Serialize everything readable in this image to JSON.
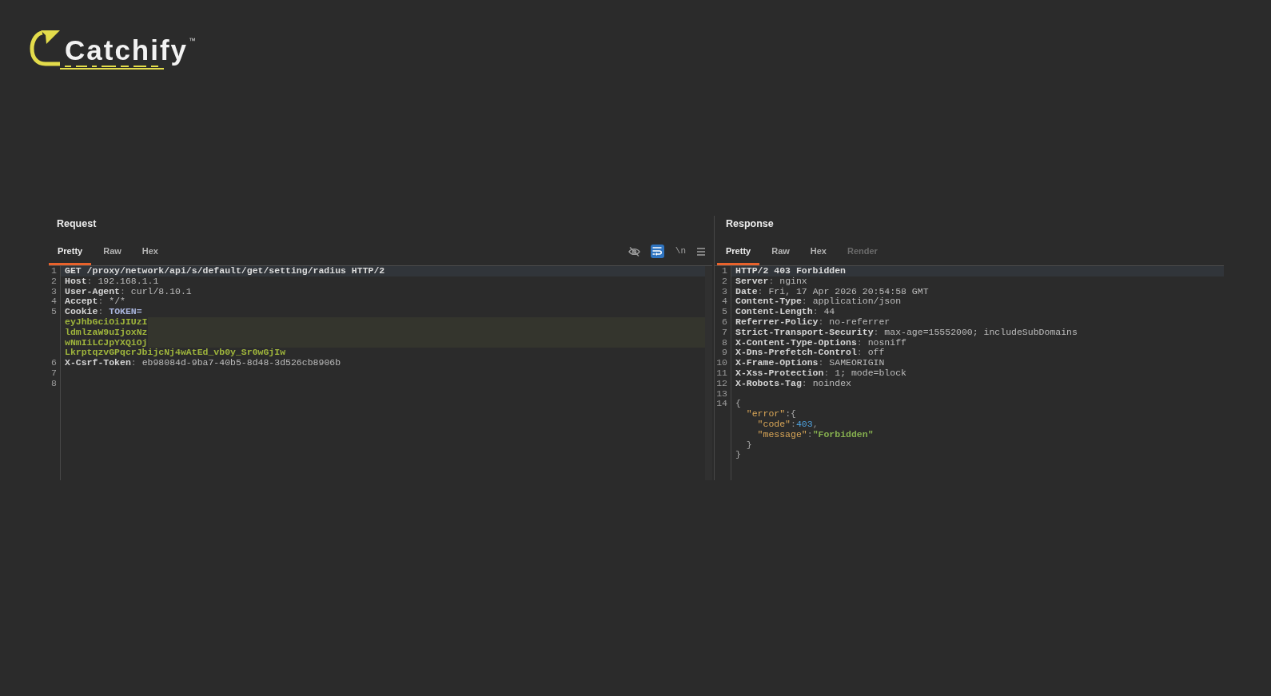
{
  "logo": {
    "name": "Catchify",
    "mark": "™"
  },
  "request": {
    "title": "Request",
    "tabs": [
      {
        "label": "Pretty",
        "selected": true,
        "disabled": false
      },
      {
        "label": "Raw",
        "selected": false,
        "disabled": false
      },
      {
        "label": "Hex",
        "selected": false,
        "disabled": false
      }
    ],
    "toolbar": [
      {
        "on": false
      },
      {
        "on": true
      },
      {
        "label": "\\n",
        "on": false
      },
      {
        "on": false
      }
    ],
    "rows": [
      {
        "number": "1",
        "highlighted": true,
        "redacted": false,
        "tokens": [
          {
            "kind": "start",
            "text": "GET /proxy/network/api/s/default/get/setting/radius HTTP/2"
          }
        ]
      },
      {
        "number": "2",
        "highlighted": false,
        "redacted": false,
        "tokens": [
          {
            "kind": "name",
            "text": "Host"
          },
          {
            "kind": "punct",
            "text": ": "
          },
          {
            "kind": "value",
            "text": "192.168.1.1"
          }
        ]
      },
      {
        "number": "3",
        "highlighted": false,
        "redacted": false,
        "tokens": [
          {
            "kind": "name",
            "text": "User-Agent"
          },
          {
            "kind": "punct",
            "text": ": "
          },
          {
            "kind": "value",
            "text": "curl/8.10.1"
          }
        ]
      },
      {
        "number": "4",
        "highlighted": false,
        "redacted": false,
        "tokens": [
          {
            "kind": "name",
            "text": "Accept"
          },
          {
            "kind": "punct",
            "text": ": "
          },
          {
            "kind": "value",
            "text": "*/*"
          }
        ]
      },
      {
        "number": "5",
        "highlighted": false,
        "redacted": false,
        "tokens": [
          {
            "kind": "name",
            "text": "Cookie"
          },
          {
            "kind": "punct",
            "text": ": "
          },
          {
            "kind": "param",
            "text": "TOKEN="
          }
        ]
      },
      {
        "highlighted": false,
        "redacted": true,
        "tokens": [
          {
            "kind": "cookie",
            "text": "eyJhbGciOiJIUzI"
          }
        ]
      },
      {
        "highlighted": false,
        "redacted": true,
        "tokens": [
          {
            "kind": "cookie",
            "text": "ldmlzaW9uIjoxNz"
          }
        ]
      },
      {
        "highlighted": false,
        "redacted": true,
        "tokens": [
          {
            "kind": "cookie",
            "text": "wNmIiLCJpYXQiOj"
          }
        ]
      },
      {
        "highlighted": false,
        "redacted": false,
        "tokens": [
          {
            "kind": "cookie",
            "text": "LkrptqzvGPqcrJbijcNj4wAtEd_vb0y_Sr0wGjIw"
          }
        ]
      },
      {
        "number": "6",
        "highlighted": false,
        "redacted": false,
        "tokens": [
          {
            "kind": "name",
            "text": "X-Csrf-Token"
          },
          {
            "kind": "punct",
            "text": ": "
          },
          {
            "kind": "value",
            "text": "eb98084d-9ba7-40b5-8d48-3d526cb8906b"
          }
        ]
      },
      {
        "number": "7",
        "highlighted": false,
        "redacted": false
      },
      {
        "number": "8",
        "highlighted": false,
        "redacted": false
      }
    ]
  },
  "response": {
    "title": "Response",
    "tabs": [
      {
        "label": "Pretty",
        "selected": true,
        "disabled": false
      },
      {
        "label": "Raw",
        "selected": false,
        "disabled": false
      },
      {
        "label": "Hex",
        "selected": false,
        "disabled": false
      },
      {
        "label": "Render",
        "selected": false,
        "disabled": true
      }
    ],
    "rows": [
      {
        "number": "1",
        "highlighted": true,
        "tokens": [
          {
            "kind": "start",
            "text": "HTTP/2 403 Forbidden"
          }
        ]
      },
      {
        "number": "2",
        "highlighted": false,
        "tokens": [
          {
            "kind": "name",
            "text": "Server"
          },
          {
            "kind": "punct",
            "text": ": "
          },
          {
            "kind": "value",
            "text": "nginx"
          }
        ]
      },
      {
        "number": "3",
        "highlighted": false,
        "tokens": [
          {
            "kind": "name",
            "text": "Date"
          },
          {
            "kind": "punct",
            "text": ": "
          },
          {
            "kind": "value",
            "text": "Fri, 17 Apr 2026 20:54:58 GMT"
          }
        ]
      },
      {
        "number": "4",
        "highlighted": false,
        "tokens": [
          {
            "kind": "name",
            "text": "Content-Type"
          },
          {
            "kind": "punct",
            "text": ": "
          },
          {
            "kind": "value",
            "text": "application/json"
          }
        ]
      },
      {
        "number": "5",
        "highlighted": false,
        "tokens": [
          {
            "kind": "name",
            "text": "Content-Length"
          },
          {
            "kind": "punct",
            "text": ": "
          },
          {
            "kind": "value",
            "text": "44"
          }
        ]
      },
      {
        "number": "6",
        "highlighted": false,
        "tokens": [
          {
            "kind": "name",
            "text": "Referrer-Policy"
          },
          {
            "kind": "punct",
            "text": ": "
          },
          {
            "kind": "value",
            "text": "no-referrer"
          }
        ]
      },
      {
        "number": "7",
        "highlighted": false,
        "tokens": [
          {
            "kind": "name",
            "text": "Strict-Transport-Security"
          },
          {
            "kind": "punct",
            "text": ": "
          },
          {
            "kind": "value",
            "text": "max-age=15552000; includeSubDomains"
          }
        ]
      },
      {
        "number": "8",
        "highlighted": false,
        "tokens": [
          {
            "kind": "name",
            "text": "X-Content-Type-Options"
          },
          {
            "kind": "punct",
            "text": ": "
          },
          {
            "kind": "value",
            "text": "nosniff"
          }
        ]
      },
      {
        "number": "9",
        "highlighted": false,
        "tokens": [
          {
            "kind": "name",
            "text": "X-Dns-Prefetch-Control"
          },
          {
            "kind": "punct",
            "text": ": "
          },
          {
            "kind": "value",
            "text": "off"
          }
        ]
      },
      {
        "number": "10",
        "highlighted": false,
        "tokens": [
          {
            "kind": "name",
            "text": "X-Frame-Options"
          },
          {
            "kind": "punct",
            "text": ": "
          },
          {
            "kind": "value",
            "text": "SAMEORIGIN"
          }
        ]
      },
      {
        "number": "11",
        "highlighted": false,
        "tokens": [
          {
            "kind": "name",
            "text": "X-Xss-Protection"
          },
          {
            "kind": "punct",
            "text": ": "
          },
          {
            "kind": "value",
            "text": "1; mode=block"
          }
        ]
      },
      {
        "number": "12",
        "highlighted": false,
        "tokens": [
          {
            "kind": "name",
            "text": "X-Robots-Tag"
          },
          {
            "kind": "punct",
            "text": ": "
          },
          {
            "kind": "value",
            "text": "noindex"
          }
        ]
      },
      {
        "number": "13",
        "highlighted": false
      },
      {
        "number": "14",
        "highlighted": false,
        "tokens": [
          {
            "kind": "brace",
            "text": "{"
          }
        ]
      },
      {
        "highlighted": false,
        "tokens": [
          {
            "kind": "key",
            "text": "  \"error\""
          },
          {
            "kind": "brace",
            "text": ":{"
          }
        ]
      },
      {
        "highlighted": false,
        "tokens": [
          {
            "kind": "key",
            "text": "    \"code\""
          },
          {
            "kind": "punct",
            "text": ":"
          },
          {
            "kind": "number",
            "text": "403"
          },
          {
            "kind": "punct",
            "text": ","
          }
        ]
      },
      {
        "highlighted": false,
        "tokens": [
          {
            "kind": "key",
            "text": "    \"message\""
          },
          {
            "kind": "punct",
            "text": ":"
          },
          {
            "kind": "string",
            "text": "\"Forbidden\""
          }
        ]
      },
      {
        "highlighted": false,
        "tokens": [
          {
            "kind": "brace",
            "text": "  }"
          }
        ]
      },
      {
        "highlighted": false,
        "tokens": [
          {
            "kind": "brace",
            "text": "}"
          }
        ]
      }
    ]
  }
}
